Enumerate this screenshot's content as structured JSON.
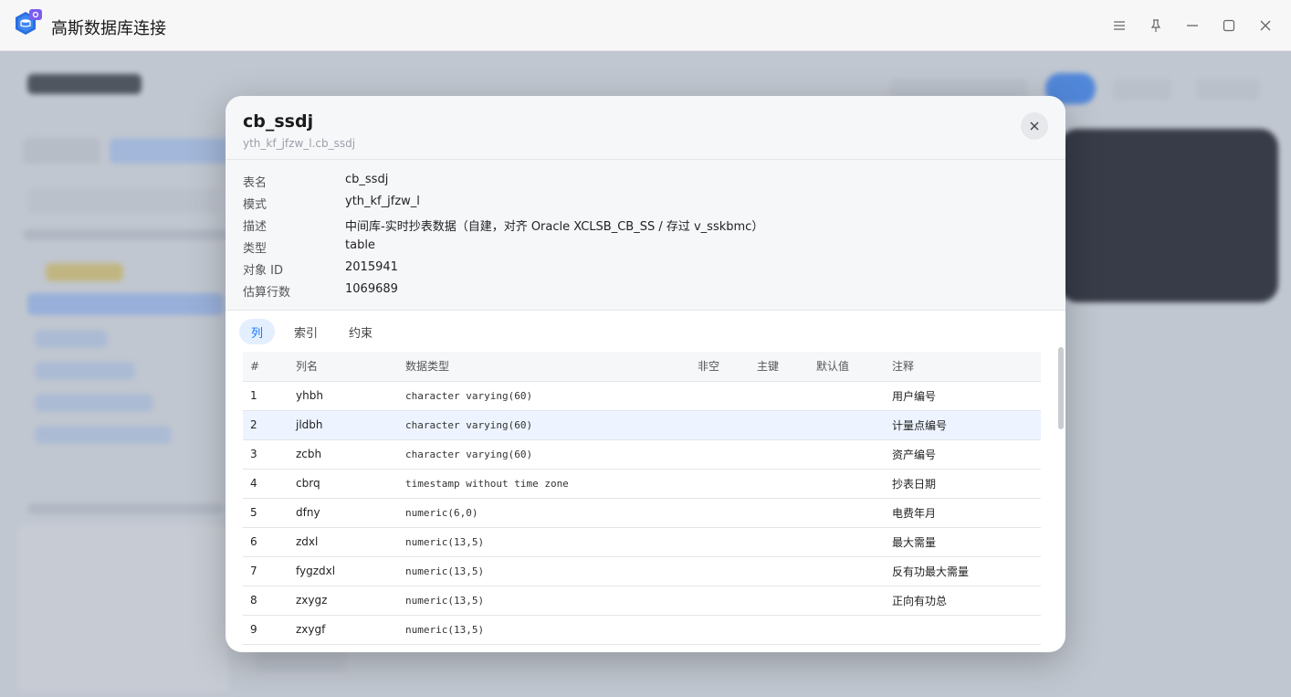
{
  "window": {
    "title": "高斯数据库连接",
    "logo_text": "GaussDB"
  },
  "modal": {
    "title": "cb_ssdj",
    "subtitle": "yth_kf_jfzw_l.cb_ssdj",
    "info": [
      {
        "key": "表名",
        "value": "cb_ssdj"
      },
      {
        "key": "模式",
        "value": "yth_kf_jfzw_l"
      },
      {
        "key": "描述",
        "value": "中间库-实时抄表数据（自建，对齐 Oracle XCLSB_CB_SS / 存过 v_sskbmc）"
      },
      {
        "key": "类型",
        "value": "table"
      },
      {
        "key": "对象 ID",
        "value": "2015941"
      },
      {
        "key": "估算行数",
        "value": "1069689"
      }
    ],
    "tabs": [
      "列",
      "索引",
      "约束"
    ],
    "active_tab": "列",
    "columns": {
      "headers": [
        "#",
        "列名",
        "数据类型",
        "非空",
        "主键",
        "默认值",
        "注释"
      ],
      "rows": [
        {
          "n": "1",
          "name": "yhbh",
          "type": "character varying(60)",
          "notnull": "",
          "pk": "",
          "default": "",
          "comment": "用户编号"
        },
        {
          "n": "2",
          "name": "jldbh",
          "type": "character varying(60)",
          "notnull": "",
          "pk": "",
          "default": "",
          "comment": "计量点编号"
        },
        {
          "n": "3",
          "name": "zcbh",
          "type": "character varying(60)",
          "notnull": "",
          "pk": "",
          "default": "",
          "comment": "资产编号"
        },
        {
          "n": "4",
          "name": "cbrq",
          "type": "timestamp without time zone",
          "notnull": "",
          "pk": "",
          "default": "",
          "comment": "抄表日期"
        },
        {
          "n": "5",
          "name": "dfny",
          "type": "numeric(6,0)",
          "notnull": "",
          "pk": "",
          "default": "",
          "comment": "电费年月"
        },
        {
          "n": "6",
          "name": "zdxl",
          "type": "numeric(13,5)",
          "notnull": "",
          "pk": "",
          "default": "",
          "comment": "最大需量"
        },
        {
          "n": "7",
          "name": "fygzdxl",
          "type": "numeric(13,5)",
          "notnull": "",
          "pk": "",
          "default": "",
          "comment": "反有功最大需量"
        },
        {
          "n": "8",
          "name": "zxygz",
          "type": "numeric(13,5)",
          "notnull": "",
          "pk": "",
          "default": "",
          "comment": "正向有功总"
        },
        {
          "n": "9",
          "name": "zxygf",
          "type": "numeric(13,5)",
          "notnull": "",
          "pk": "",
          "default": "",
          "comment": ""
        }
      ]
    }
  },
  "colors": {
    "accent": "#1677ff",
    "row_highlight": "#edf4ff"
  }
}
